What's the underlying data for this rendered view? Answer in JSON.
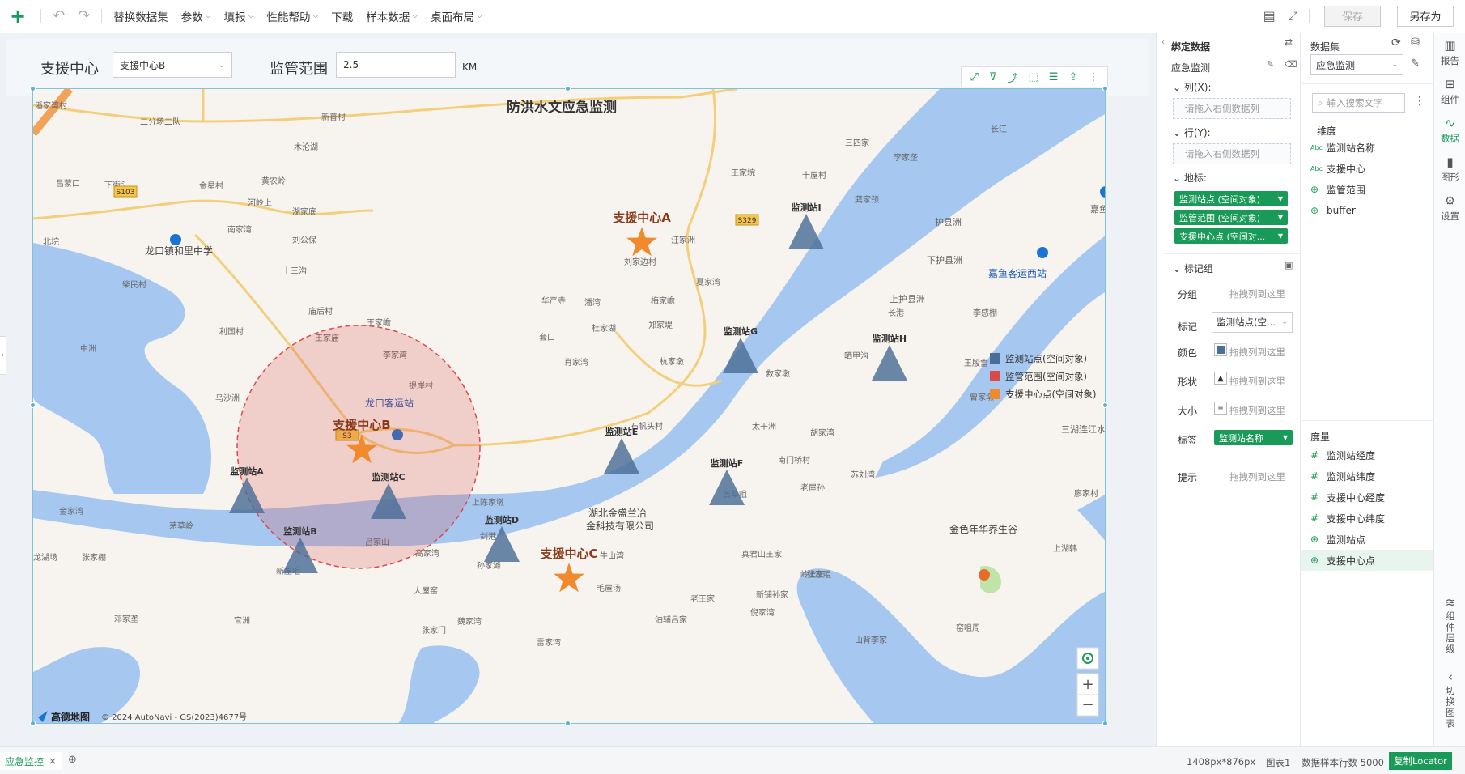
{
  "toolbar": {
    "items": [
      {
        "label": "替换数据集",
        "chev": false
      },
      {
        "label": "参数",
        "chev": true
      },
      {
        "label": "填报",
        "chev": true
      },
      {
        "label": "性能帮助",
        "chev": true
      },
      {
        "label": "下载",
        "chev": false
      },
      {
        "label": "样本数据",
        "chev": true
      },
      {
        "label": "桌面布局",
        "chev": true
      }
    ],
    "save_label": "保存",
    "saveas_label": "另存为"
  },
  "params": {
    "center_label": "支援中心",
    "center_value": "支援中心B",
    "range_label": "监管范围",
    "range_value": "2.5",
    "range_unit": "KM"
  },
  "map": {
    "title": "防洪水文应急监测",
    "stations": [
      {
        "name": "监测站I"
      },
      {
        "name": "监测站G"
      },
      {
        "name": "监测站H"
      },
      {
        "name": "监测站E"
      },
      {
        "name": "监测站F"
      },
      {
        "name": "监测站A"
      },
      {
        "name": "监测站C"
      },
      {
        "name": "监测站B"
      },
      {
        "name": "监测站D"
      }
    ],
    "centers": [
      {
        "name": "支援中心A"
      },
      {
        "name": "支援中心B"
      },
      {
        "name": "支援中心C"
      }
    ],
    "legend": [
      {
        "label": "监测站点(空间对象)",
        "color": "#4b6e96"
      },
      {
        "label": "监管范围(空间对象)",
        "color": "#d94a4a"
      },
      {
        "label": "支援中心点(空间对象)",
        "color": "#f08a2c"
      }
    ],
    "places": [
      "潘家湾村",
      "二分场二队",
      "新普村",
      "木沦湖",
      "吕蒙口",
      "下街头",
      "金星村",
      "黄农岭",
      "河岭上",
      "湖家底",
      "南家湾",
      "刘公保",
      "北垸",
      "龙口镇和里中学",
      "十三沟",
      "柴民村",
      "中洲",
      "利国村",
      "庙后村",
      "王家嶦",
      "王家庙",
      "李家湾",
      "乌沙洲",
      "提岸村",
      "龙口客运站",
      "石帆头村",
      "太平洲",
      "胡家湾",
      "南门桥村",
      "老屋孙",
      "苏刘湾",
      "三湖连江水",
      "廖家村",
      "苦草咀",
      "金色年华养生谷",
      "湖北金盛兰冶",
      "金科技有限公司",
      "上陈家墩",
      "剑港",
      "吕家山",
      "高家湾",
      "金家湾",
      "茅草岭",
      "龙湖场",
      "张家棚",
      "新屋咀",
      "孙家滩",
      "大屋窑",
      "毛屋汤",
      "老王家",
      "牛山湾",
      "真君山王家",
      "岭上王",
      "张家咀",
      "新铺孙家",
      "倪家湾",
      "邓家垄",
      "官洲",
      "张家门",
      "魏家湾",
      "油辅吕家",
      "雷家湾",
      "山背李家",
      "窑咀周",
      "上湖韩",
      "嘉鱼县城",
      "护县洲",
      "下护县洲",
      "嘉鱼客运西站",
      "上护县洲",
      "长港",
      "李感棚",
      "晒甲沟",
      "王殷雷",
      "曾家墩",
      "救家墩",
      "华严寺",
      "潘湾",
      "杜家湖",
      "郑家堤",
      "套口",
      "肖家湾",
      "杭家墩",
      "刘家边村",
      "汪家洲",
      "梅家嶦",
      "夏家湾",
      "王家垸",
      "十屋村",
      "三四家",
      "长江",
      "龚家颈",
      "李家垄"
    ],
    "roads": [
      "S103",
      "S329",
      "S3"
    ],
    "attribution": "© 2024 AutoNavi - GS(2023)4677号",
    "logo": "高德地图"
  },
  "bind_panel": {
    "title": "绑定数据",
    "source": "应急监测",
    "cols_label": "列(X):",
    "rows_label": "行(Y):",
    "drop_hint": "请拖入右侧数据列",
    "geo_label": "地标:",
    "geo_chips": [
      "监测站点 (空间对象)",
      "监管范围 (空间对象)",
      "支援中心点 (空间对..."
    ],
    "marker_group": "标记组",
    "group_label": "分组",
    "drag_hint": "拖拽列到这里",
    "mark_label": "标记",
    "mark_value": "监测站点(空...",
    "color_label": "颜色",
    "shape_label": "形状",
    "size_label": "大小",
    "tag_label": "标签",
    "tag_value": "监测站名称",
    "tip_label": "提示"
  },
  "dataset_panel": {
    "title": "数据集",
    "selected": "应急监测",
    "search_placeholder": "输入搜索文字",
    "dim_title": "维度",
    "dims": [
      {
        "type": "Abc",
        "label": "监测站名称"
      },
      {
        "type": "Abc",
        "label": "支援中心"
      },
      {
        "type": "geo",
        "label": "监管范围"
      },
      {
        "type": "geo",
        "label": "buffer"
      }
    ],
    "measure_title": "度量",
    "measures": [
      {
        "type": "#",
        "label": "监测站经度"
      },
      {
        "type": "#",
        "label": "监测站纬度"
      },
      {
        "type": "#",
        "label": "支援中心经度"
      },
      {
        "type": "#",
        "label": "支援中心纬度"
      },
      {
        "type": "geo",
        "label": "监测站点"
      },
      {
        "type": "geo",
        "label": "支援中心点"
      }
    ]
  },
  "side_tabs": [
    "报告",
    "组件",
    "数据",
    "图形",
    "设置"
  ],
  "side_bottom": [
    "组件层级",
    "切换图表"
  ],
  "status": {
    "tab": "应急监控",
    "size": "1408px*876px",
    "chart": "图表1",
    "sample": "数据样本行数 5000",
    "locator": "复制Locator"
  }
}
